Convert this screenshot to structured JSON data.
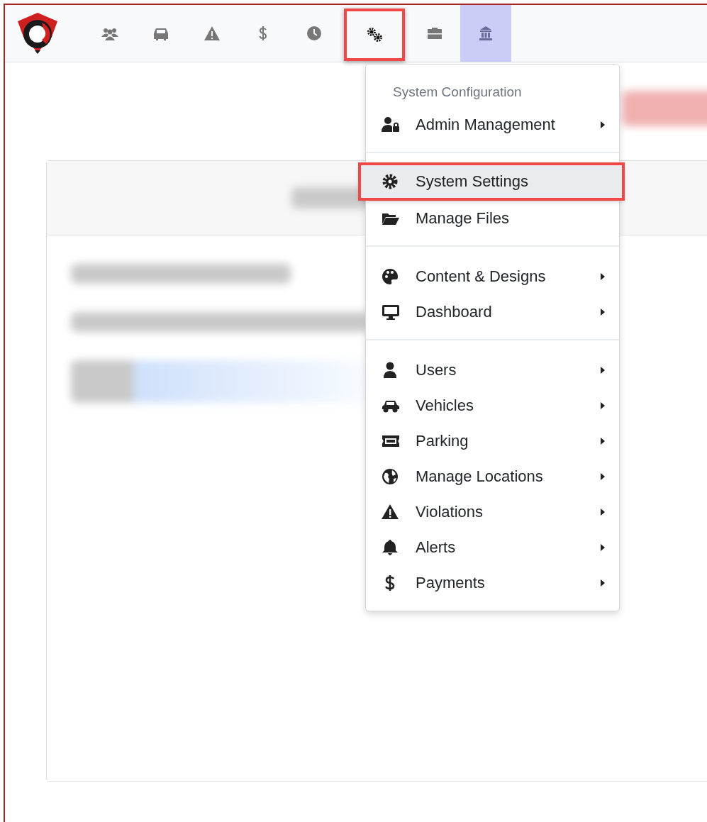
{
  "navbar": {
    "items": [
      {
        "selected": false,
        "annotated": false
      },
      {
        "selected": false,
        "annotated": false
      },
      {
        "selected": false,
        "annotated": false
      },
      {
        "selected": false,
        "annotated": false
      },
      {
        "selected": false,
        "annotated": false
      },
      {
        "selected": false,
        "annotated": true
      },
      {
        "selected": false,
        "annotated": false
      },
      {
        "selected": true,
        "annotated": false
      }
    ]
  },
  "menu": {
    "header": "System Configuration",
    "groups": [
      [
        {
          "label": "Admin Management",
          "submenu": true,
          "selected": false,
          "annotated": false
        }
      ],
      [
        {
          "label": "System Settings",
          "submenu": false,
          "selected": true,
          "annotated": true
        },
        {
          "label": "Manage Files",
          "submenu": false,
          "selected": false,
          "annotated": false
        }
      ],
      [
        {
          "label": "Content & Designs",
          "submenu": true,
          "selected": false,
          "annotated": false
        },
        {
          "label": "Dashboard",
          "submenu": true,
          "selected": false,
          "annotated": false
        }
      ],
      [
        {
          "label": "Users",
          "submenu": true,
          "selected": false,
          "annotated": false
        },
        {
          "label": "Vehicles",
          "submenu": true,
          "selected": false,
          "annotated": false
        },
        {
          "label": "Parking",
          "submenu": true,
          "selected": false,
          "annotated": false
        },
        {
          "label": "Manage Locations",
          "submenu": true,
          "selected": false,
          "annotated": false
        },
        {
          "label": "Violations",
          "submenu": true,
          "selected": false,
          "annotated": false
        },
        {
          "label": "Alerts",
          "submenu": true,
          "selected": false,
          "annotated": false
        },
        {
          "label": "Payments",
          "submenu": true,
          "selected": false,
          "annotated": false
        }
      ]
    ]
  }
}
